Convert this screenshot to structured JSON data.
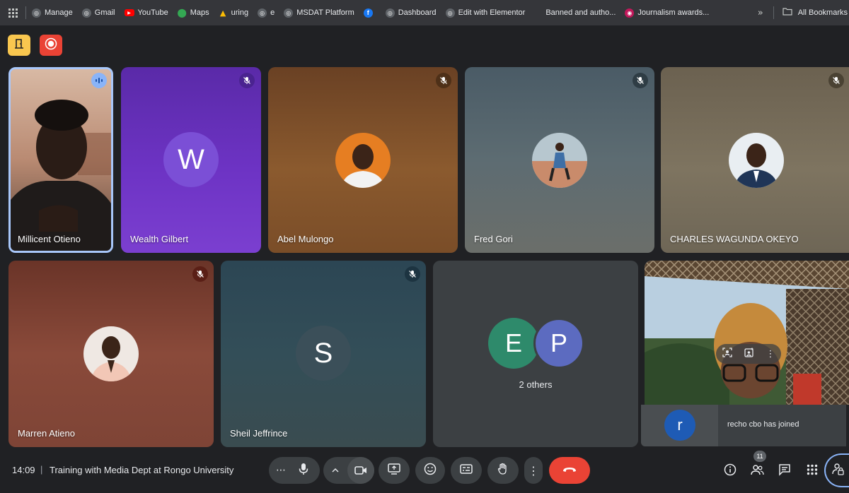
{
  "bookmarks": {
    "items": [
      {
        "label": "Manage",
        "icon": "globe-icon"
      },
      {
        "label": "Gmail",
        "icon": "globe-icon"
      },
      {
        "label": "YouTube",
        "icon": "youtube-icon"
      },
      {
        "label": "Maps",
        "icon": "maps-pin-icon"
      },
      {
        "label": "uring",
        "icon": "drive-icon"
      },
      {
        "label": "e",
        "icon": "globe-icon"
      },
      {
        "label": "MSDAT Platform",
        "icon": "globe-icon"
      },
      {
        "label": "",
        "icon": "facebook-icon"
      },
      {
        "label": "Dashboard",
        "icon": "globe-icon"
      },
      {
        "label": "Edit with Elementor",
        "icon": "globe-icon"
      },
      {
        "label": "Banned and autho...",
        "icon": "none"
      },
      {
        "label": "Journalism awards...",
        "icon": "awards-icon"
      }
    ],
    "all_bookmarks": "All Bookmarks"
  },
  "participants": [
    {
      "name": "Millicent Otieno",
      "speaking": true
    },
    {
      "name": "Wealth Gilbert",
      "initial": "W",
      "muted": true
    },
    {
      "name": "Abel Mulongo",
      "muted": true
    },
    {
      "name": "Fred Gori",
      "muted": true
    },
    {
      "name": "CHARLES WAGUNDA OKEYO",
      "muted": true
    },
    {
      "name": "Marren Atieno",
      "muted": true
    },
    {
      "name": "Sheil Jeffrince",
      "initial": "S",
      "muted": true
    }
  ],
  "others": {
    "initials": [
      "E",
      "P"
    ],
    "label": "2 others"
  },
  "notification": {
    "initial": "r",
    "text": "recho cbo has joined"
  },
  "bottom_bar": {
    "time": "14:09",
    "separator": "|",
    "meeting_title": "Training with Media Dept at Rongo University",
    "people_count": "11"
  },
  "colors": {
    "background": "#202124",
    "control_bg": "#3c4043",
    "end_call": "#ea4335",
    "speaking_border": "#a8c7fa",
    "avatar_w": "#7b3fd0",
    "avatar_e": "#2e8a6b",
    "avatar_p": "#5c6bc0",
    "avatar_r": "#1e5bb5"
  }
}
